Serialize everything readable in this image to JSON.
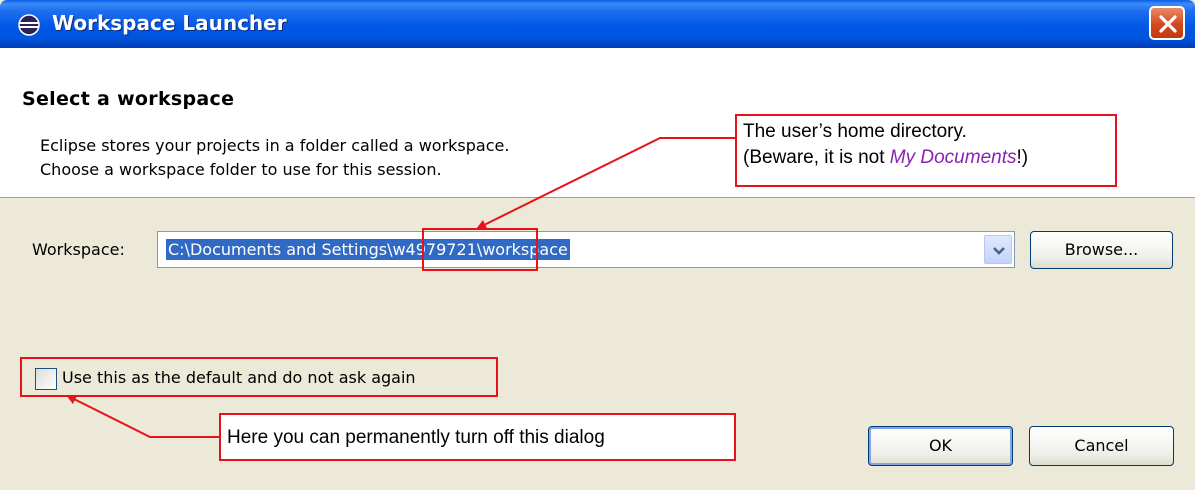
{
  "window": {
    "title": "Workspace Launcher",
    "title_icon": "eclipse-icon",
    "close_icon": "close-icon"
  },
  "header": {
    "title": "Select a workspace",
    "description_line1": "Eclipse stores your projects in a folder called a workspace.",
    "description_line2": "Choose a workspace folder to use for this session."
  },
  "workspace": {
    "label": "Workspace:",
    "value": "C:\\Documents and Settings\\w4979721\\workspace",
    "dropdown_icon": "chevron-down-icon",
    "browse_label": "Browse..."
  },
  "default_option": {
    "label": "Use this as the default and do not ask again",
    "checked": false
  },
  "buttons": {
    "ok_label": "OK",
    "cancel_label": "Cancel"
  },
  "annotations": {
    "home_line1": "The user’s home directory.",
    "home_line2_prefix": "(Beware, it is not ",
    "home_line2_emphasis": "My Documents",
    "home_line2_suffix": "!)",
    "dialog_note": "Here you can permanently turn off this dialog",
    "accent_color": "#e8121a",
    "emphasis_color": "#8b22b0"
  },
  "colors": {
    "titlebar": "#0054e3",
    "dialog_background": "#ece9d8",
    "selection": "#316ac5"
  }
}
